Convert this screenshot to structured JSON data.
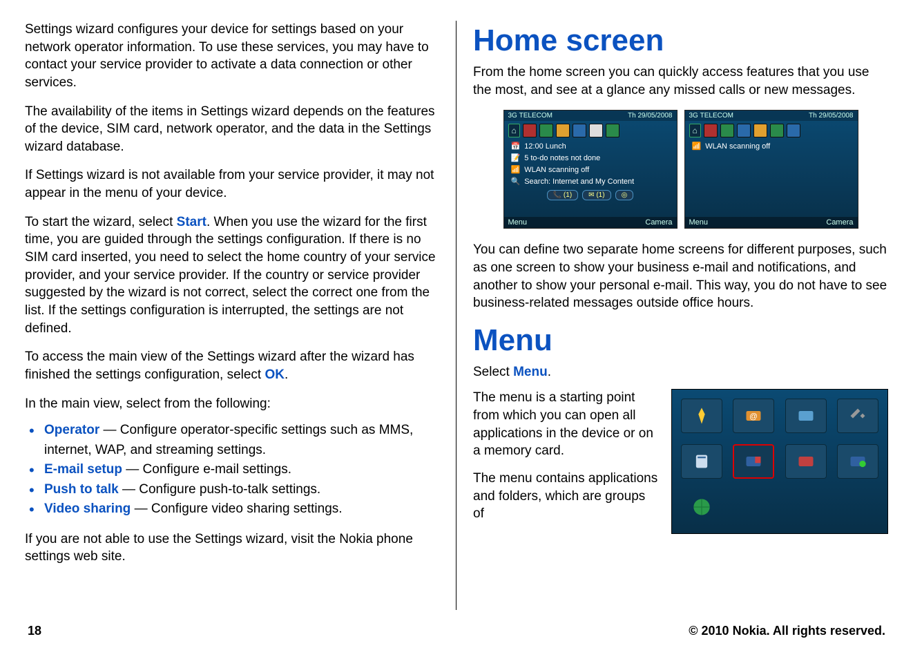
{
  "left": {
    "p1": "Settings wizard configures your device for settings based on your network operator information. To use these services, you may have to contact your service provider to activate a data connection or other services.",
    "p2": "The availability of the items in Settings wizard depends on the features of the device, SIM card, network operator, and the data in the Settings wizard database.",
    "p3": "If Settings wizard is not available from your service provider, it may not appear in the menu of your device.",
    "p4a": "To start the wizard, select ",
    "p4_term": "Start",
    "p4b": ". When you use the wizard for the first time, you are guided through the settings configuration. If there is no SIM card inserted, you need to select the home country of your service provider, and your service provider. If the country or service provider suggested by the wizard is not correct, select the correct one from the list. If the settings configuration is interrupted, the settings are not defined.",
    "p5a": "To access the main view of the Settings wizard after the wizard has finished the settings configuration, select ",
    "p5_term": "OK",
    "p5b": ".",
    "p6": "In the main view, select from the following:",
    "options": [
      {
        "term": "Operator",
        "desc": " — Configure operator-specific settings such as MMS, internet, WAP, and streaming settings."
      },
      {
        "term": "E-mail setup",
        "desc": " — Configure e-mail settings."
      },
      {
        "term": "Push to talk",
        "desc": " — Configure push-to-talk settings."
      },
      {
        "term": "Video sharing",
        "desc": " — Configure video sharing settings."
      }
    ],
    "p7": "If you are not able to use the Settings wizard, visit the Nokia phone settings web site."
  },
  "right": {
    "h1": "Home screen",
    "p1": "From the home screen you can quickly access features that you use the most, and see at a glance any missed calls or new messages.",
    "screen": {
      "operator": "TELECOM",
      "date": "Th 29/05/2008",
      "lines_a": [
        "12:00 Lunch",
        "5 to-do notes not done",
        "WLAN scanning off",
        "Search: Internet and My Content"
      ],
      "chips": [
        "(1)",
        "(1)"
      ],
      "lines_b": [
        "WLAN scanning off"
      ],
      "soft_left": "Menu",
      "soft_right": "Camera",
      "net": "3G"
    },
    "p2": "You can define two separate home screens for different purposes, such as one screen to show your business e-mail and notifications, and another to show your personal e-mail. This way, you do not have to see business-related messages outside office hours.",
    "h2": "Menu",
    "menu_select_a": "Select ",
    "menu_select_term": "Menu",
    "menu_select_b": ".",
    "menu_p1": "The menu is a starting point from which you can open all applications in the device or on a memory card.",
    "menu_p2": "The menu contains applications and folders, which are groups of"
  },
  "footer": {
    "page": "18",
    "copyright": "© 2010 Nokia. All rights reserved."
  }
}
